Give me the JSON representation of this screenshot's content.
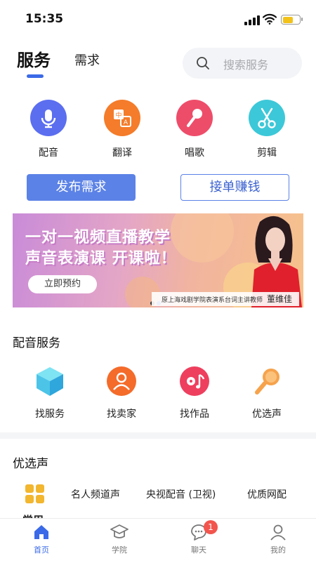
{
  "status_bar": {
    "time": "15:35"
  },
  "header": {
    "tab_active": "服务",
    "tab_other": "需求",
    "search_placeholder": "搜索服务"
  },
  "quick_services": [
    {
      "label": "配音",
      "icon": "microphone-icon",
      "color": "#5b6ef0"
    },
    {
      "label": "翻译",
      "icon": "translate-icon",
      "color": "#f47c2a"
    },
    {
      "label": "唱歌",
      "icon": "karaoke-mic-icon",
      "color": "#ee4d6a"
    },
    {
      "label": "剪辑",
      "icon": "scissors-icon",
      "color": "#3cc8d8"
    }
  ],
  "actions": {
    "publish": "发布需求",
    "take_orders": "接单赚钱"
  },
  "banner": {
    "line1": "一对一视频直播教学",
    "line2": "声音表演课 开课啦！",
    "button": "立即预约",
    "caption": "原上海戏剧学院表演系台词主讲教师",
    "teacher": "董维佳"
  },
  "voice_section": {
    "title": "配音服务",
    "items": [
      {
        "label": "找服务",
        "icon": "cube-icon"
      },
      {
        "label": "找卖家",
        "icon": "person-icon"
      },
      {
        "label": "找作品",
        "icon": "music-disc-icon"
      },
      {
        "label": "优选声",
        "icon": "microphone-icon"
      }
    ]
  },
  "premium_section": {
    "title": "优选声",
    "grid_label": "常用",
    "categories": [
      "名人频道声",
      "央视配音 (卫视)",
      "优质网配"
    ]
  },
  "tabbar": {
    "items": [
      {
        "label": "首页",
        "icon": "home-icon",
        "active": true
      },
      {
        "label": "学院",
        "icon": "graduation-cap-icon",
        "active": false
      },
      {
        "label": "聊天",
        "icon": "chat-icon",
        "active": false,
        "badge": "1"
      },
      {
        "label": "我的",
        "icon": "user-icon",
        "active": false
      }
    ]
  },
  "colors": {
    "accent": "#3b6ae8",
    "button_blue": "#5b82e6",
    "badge_red": "#f2554d"
  }
}
